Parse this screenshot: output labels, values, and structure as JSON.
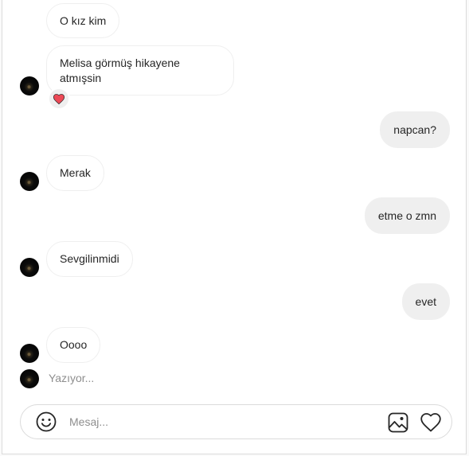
{
  "messages": [
    {
      "side": "in",
      "text": "O kız kim"
    },
    {
      "side": "in",
      "text": "Melisa görmüş hikayene atmışsin",
      "reaction": "heart-icon"
    },
    {
      "side": "out",
      "text": "napcan?"
    },
    {
      "side": "in",
      "text": "Merak"
    },
    {
      "side": "out",
      "text": "etme o zmn"
    },
    {
      "side": "in",
      "text": "Sevgilinmidi"
    },
    {
      "side": "out",
      "text": "evet"
    },
    {
      "side": "in",
      "text": "Oooo"
    }
  ],
  "typing": {
    "text": "Yazıyor..."
  },
  "composer": {
    "placeholder": "Mesaj...",
    "icons": [
      "emoji-icon",
      "image-icon",
      "heart-icon"
    ]
  },
  "colors": {
    "incoming_bubble": "#ffffff",
    "outgoing_bubble": "#efefef",
    "border": "#dbdbdb",
    "reaction_heart": "#ed4956",
    "text": "#262626",
    "muted": "#8e8e8e"
  }
}
